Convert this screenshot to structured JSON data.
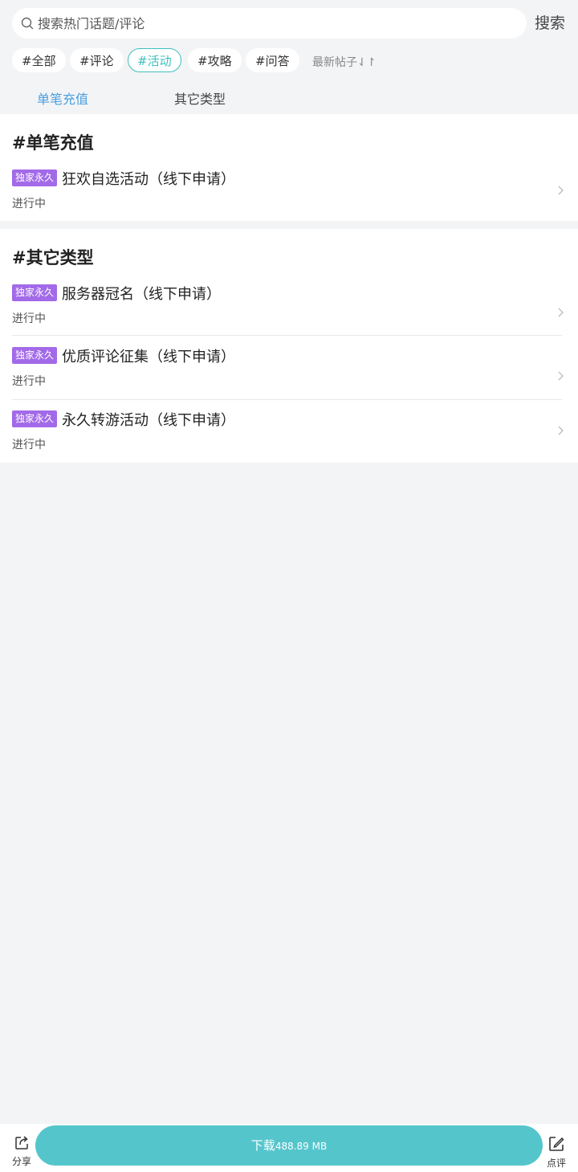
{
  "search": {
    "placeholder": "搜索热门话题/评论",
    "button_label": "搜索"
  },
  "tags": [
    {
      "label": "#全部",
      "active": false
    },
    {
      "label": "#评论",
      "active": false
    },
    {
      "label": "#活动",
      "active": true
    },
    {
      "label": "#攻略",
      "active": false
    },
    {
      "label": "#问答",
      "active": false
    }
  ],
  "sort_label": "最新帖子⇃↾",
  "subtabs": [
    {
      "label": "单笔充值",
      "active": true
    },
    {
      "label": "其它类型",
      "active": false
    }
  ],
  "sections": [
    {
      "title": "#单笔充值",
      "items": [
        {
          "badge": "独家永久",
          "title": "狂欢自选活动（线下申请）",
          "status": "进行中"
        }
      ]
    },
    {
      "title": "#其它类型",
      "items": [
        {
          "badge": "独家永久",
          "title": "服务器冠名（线下申请）",
          "status": "进行中"
        },
        {
          "badge": "独家永久",
          "title": "优质评论征集（线下申请）",
          "status": "进行中"
        },
        {
          "badge": "独家永久",
          "title": "永久转游活动（线下申请）",
          "status": "进行中"
        }
      ]
    }
  ],
  "bottom": {
    "share_label": "分享",
    "download_label": "下载",
    "download_size": "488.89 MB",
    "review_label": "点评"
  },
  "colors": {
    "accent": "#3fbfbf",
    "badge": "#a26ae8",
    "download": "#55c5cc",
    "tab_active": "#4a9fe0"
  },
  "icons": {
    "search": "search-icon",
    "chevron": "chevron-right-icon",
    "share": "share-icon",
    "review": "edit-icon"
  }
}
